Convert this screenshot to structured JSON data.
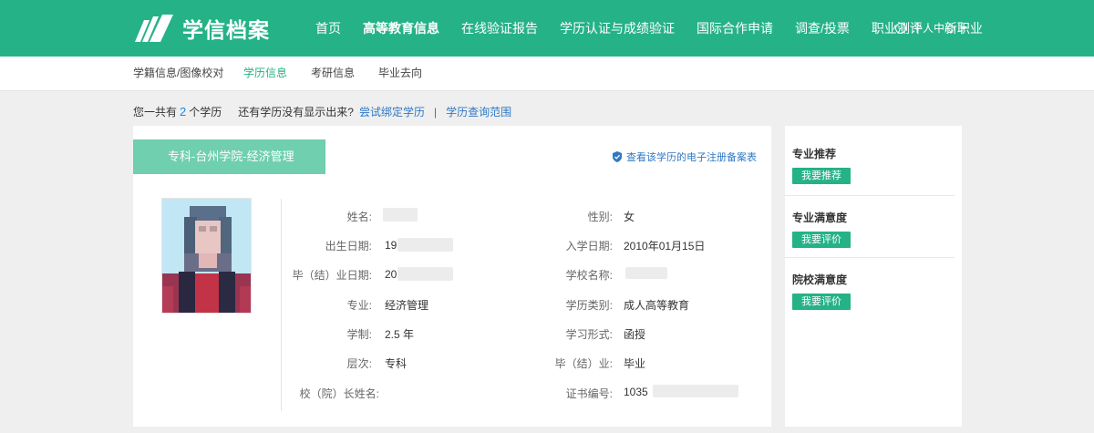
{
  "brand": {
    "name": "学信档案"
  },
  "nav": {
    "items": [
      "首页",
      "高等教育信息",
      "在线验证报告",
      "学历认证与成绩验证",
      "国际合作申请",
      "调查/投票",
      "职业测评",
      "新职业"
    ],
    "active": "高等教育信息",
    "user_center": "个人中心"
  },
  "subnav": {
    "items": [
      "学籍信息/图像校对",
      "学历信息",
      "考研信息",
      "毕业去向"
    ],
    "active": "学历信息"
  },
  "summary": {
    "prefix": "您一共有",
    "count": "2",
    "suffix": "个学历",
    "question": "还有学历没有显示出来?",
    "bind_link": "尝试绑定学历",
    "separator": "|",
    "scope_link": "学历查询范围"
  },
  "record": {
    "ribbon_title": "专科-台州学院-经济管理",
    "e_record_link": "查看该学历的电子注册备案表",
    "fields": {
      "name_label": "姓名:",
      "gender_label": "性别:",
      "gender_value": "女",
      "birth_label": "出生日期:",
      "birth_value": "19",
      "enroll_label": "入学日期:",
      "enroll_value": "2010年01月15日",
      "grad_date_label": "毕（结）业日期:",
      "grad_date_value": "20",
      "school_label": "学校名称:",
      "major_label": "专业:",
      "major_value": "经济管理",
      "edu_type_label": "学历类别:",
      "edu_type_value": "成人高等教育",
      "duration_label": "学制:",
      "duration_value": "2.5 年",
      "study_form_label": "学习形式:",
      "study_form_value": "函授",
      "level_label": "层次:",
      "level_value": "专科",
      "grad_status_label": "毕（结）业:",
      "grad_status_value": "毕业",
      "president_label": "校（院）长姓名:",
      "cert_label": "证书编号:",
      "cert_value": "1035"
    }
  },
  "side": {
    "sections": [
      {
        "title": "专业推荐",
        "button": "我要推荐"
      },
      {
        "title": "专业满意度",
        "button": "我要评价"
      },
      {
        "title": "院校满意度",
        "button": "我要评价"
      }
    ]
  },
  "colors": {
    "brand_green": "#25b286",
    "ribbon_green": "#6fcfae",
    "link_blue": "#2f78c4"
  }
}
